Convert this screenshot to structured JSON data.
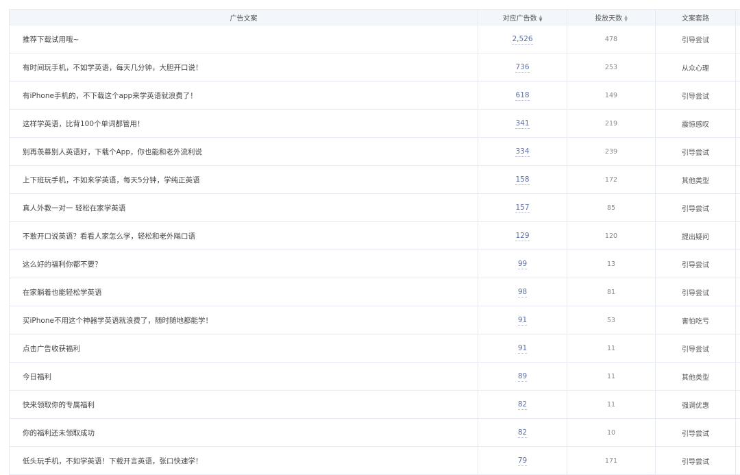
{
  "headers": {
    "text": "广告文案",
    "count": "对应广告数",
    "days": "投放天数",
    "type": "文案套路"
  },
  "sort_icons": {
    "up": "▲",
    "down": "▼"
  },
  "rows": [
    {
      "text": "推荐下载试用哦~",
      "count": "2,526",
      "days": "478",
      "type": "引导尝试"
    },
    {
      "text": "有时间玩手机，不如学英语，每天几分钟，大胆开口说！",
      "count": "736",
      "days": "253",
      "type": "从众心理"
    },
    {
      "text": "有iPhone手机的，不下载这个app来学英语就浪费了！",
      "count": "618",
      "days": "149",
      "type": "引导尝试"
    },
    {
      "text": "这样学英语，比背100个单词都管用！",
      "count": "341",
      "days": "219",
      "type": "震惊感叹"
    },
    {
      "text": "别再羡慕别人英语好，下载个App，你也能和老外流利说",
      "count": "334",
      "days": "239",
      "type": "引导尝试"
    },
    {
      "text": "上下班玩手机，不如来学英语，每天5分钟，学纯正英语",
      "count": "158",
      "days": "172",
      "type": "其他类型"
    },
    {
      "text": "真人外教一对一 轻松在家学英语",
      "count": "157",
      "days": "85",
      "type": "引导尝试"
    },
    {
      "text": "不敢开口说英语？看看人家怎么学，轻松和老外飚口语",
      "count": "129",
      "days": "120",
      "type": "提出疑问"
    },
    {
      "text": "这么好的福利你都不要？",
      "count": "99",
      "days": "13",
      "type": "引导尝试"
    },
    {
      "text": "在家躺着也能轻松学英语",
      "count": "98",
      "days": "81",
      "type": "引导尝试"
    },
    {
      "text": "买iPhone不用这个神器学英语就浪费了，随时随地都能学！",
      "count": "91",
      "days": "53",
      "type": "害怕吃亏"
    },
    {
      "text": "点击广告收获福利",
      "count": "91",
      "days": "11",
      "type": "引导尝试"
    },
    {
      "text": "今日福利",
      "count": "89",
      "days": "11",
      "type": "其他类型"
    },
    {
      "text": "快来领取你的专属福利",
      "count": "82",
      "days": "11",
      "type": "强调优惠"
    },
    {
      "text": "你的福利还未领取成功",
      "count": "82",
      "days": "10",
      "type": "引导尝试"
    },
    {
      "text": "低头玩手机，不如学英语！下载开言英语，张口快速学！",
      "count": "79",
      "days": "171",
      "type": "引导尝试"
    }
  ]
}
